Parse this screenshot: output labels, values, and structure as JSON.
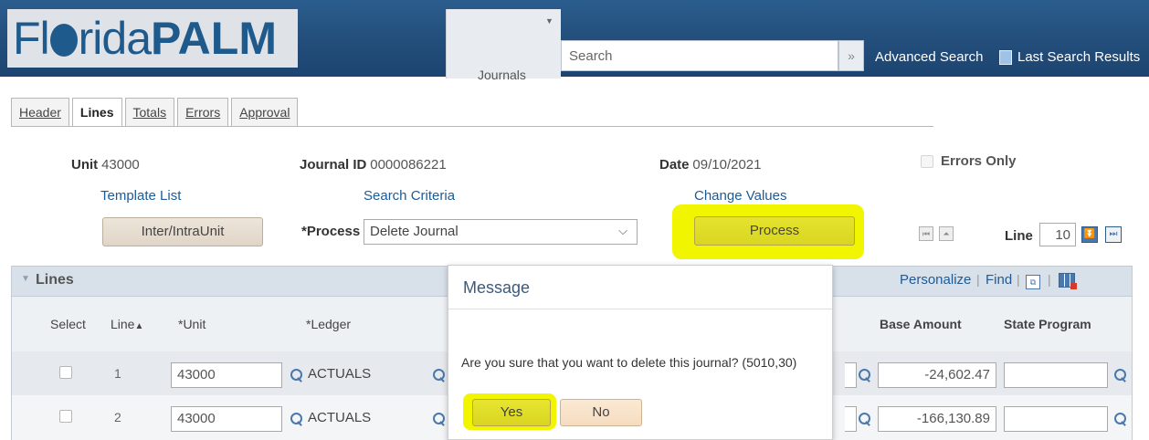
{
  "header": {
    "logo_thin": "Fl",
    "logo_thin2": "rida",
    "logo_bold": "PALM",
    "journals_label": "Journals",
    "search_placeholder": "Search",
    "advanced_search": "Advanced Search",
    "last_search_results": "Last Search Results",
    "colors": {
      "bar": "#244f7c",
      "logo": "#1f5a8c"
    }
  },
  "tabs": [
    {
      "label": "Header",
      "active": false
    },
    {
      "label": "Lines",
      "active": true
    },
    {
      "label": "Totals",
      "active": false
    },
    {
      "label": "Errors",
      "active": false
    },
    {
      "label": "Approval",
      "active": false
    }
  ],
  "info": {
    "unit_label": "Unit",
    "unit_value": "43000",
    "journal_id_label": "Journal ID",
    "journal_id_value": "0000086221",
    "date_label": "Date",
    "date_value": "09/10/2021",
    "errors_only_label": "Errors Only",
    "template_list": "Template List",
    "search_criteria": "Search Criteria",
    "change_values": "Change Values",
    "inter_intra_button": "Inter/IntraUnit",
    "process_label": "*Process",
    "process_value": "Delete Journal",
    "process_button": "Process",
    "line_label": "Line",
    "line_value": "10"
  },
  "grid": {
    "title": "Lines",
    "personalize": "Personalize",
    "find": "Find",
    "columns": [
      "Select",
      "Line",
      "*Unit",
      "*Ledger",
      "Base Amount",
      "State Program"
    ],
    "rows": [
      {
        "line": "1",
        "unit": "43000",
        "ledger": "ACTUALS",
        "base_amount": "-24,602.47"
      },
      {
        "line": "2",
        "unit": "43000",
        "ledger": "ACTUALS",
        "base_amount": "-166,130.89"
      }
    ]
  },
  "modal": {
    "title": "Message",
    "message": "Are you sure that you want to delete this journal? (5010,30)",
    "yes": "Yes",
    "no": "No",
    "highlight_color": "#f2f500"
  }
}
